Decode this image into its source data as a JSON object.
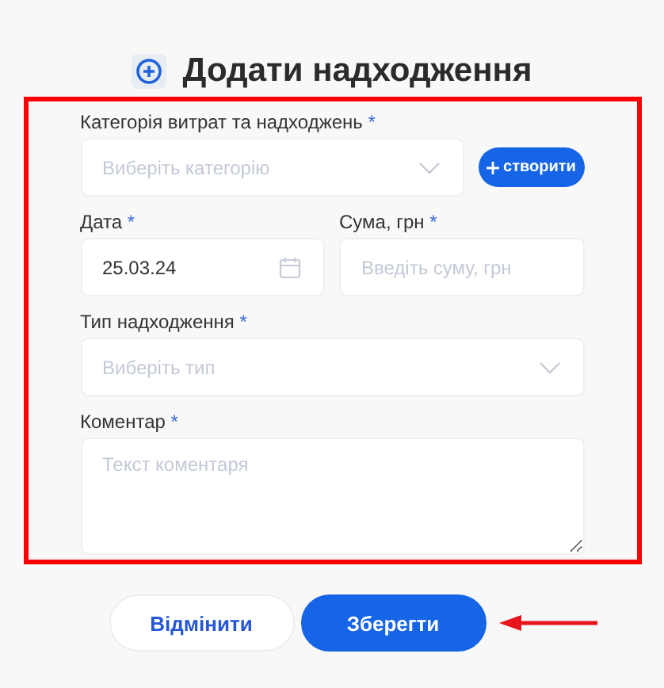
{
  "title": "Додати надходження",
  "form": {
    "category": {
      "label": "Категорія витрат та надходжень",
      "star": "*",
      "placeholder": "Виберіть категорію",
      "create_button": "створити"
    },
    "date": {
      "label": "Дата",
      "star": "*",
      "value": "25.03.24"
    },
    "amount": {
      "label": "Сума, грн",
      "star": "*",
      "placeholder": "Введіть суму, грн"
    },
    "type": {
      "label": "Тип надходження",
      "star": "*",
      "placeholder": "Виберіть тип"
    },
    "comment": {
      "label": "Коментар",
      "star": "*",
      "placeholder": "Текст коментаря"
    }
  },
  "buttons": [
    {
      "label": "Відмінити",
      "kind": "secondary"
    },
    {
      "label": "Зберегти",
      "kind": "primary"
    }
  ]
}
